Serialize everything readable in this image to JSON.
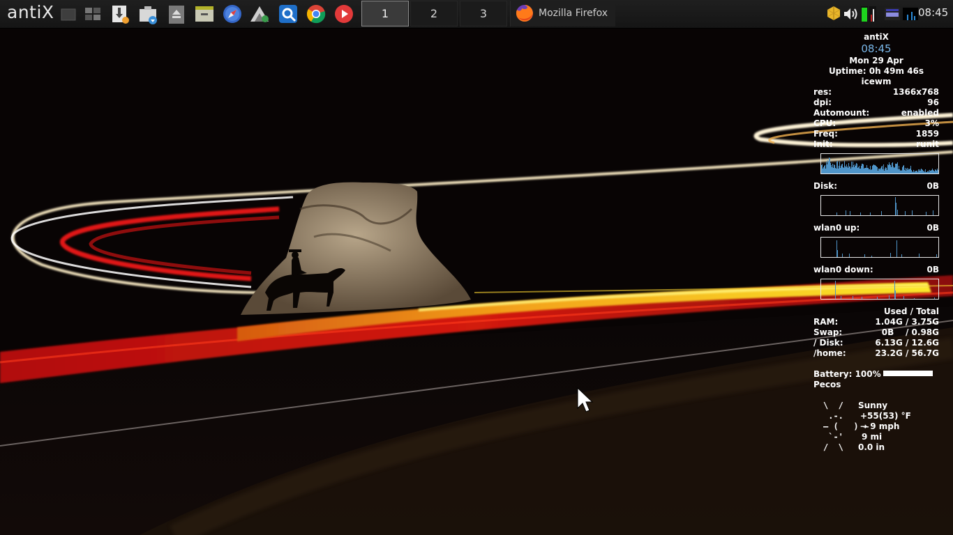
{
  "taskbar": {
    "start_label": "antiX",
    "launchers": [
      {
        "name": "show-desktop-icon"
      },
      {
        "name": "desktop-grid-icon"
      },
      {
        "name": "download-manager-icon"
      },
      {
        "name": "package-installer-icon"
      },
      {
        "name": "eject-icon"
      },
      {
        "name": "file-manager-icon"
      },
      {
        "name": "compass-browser-icon"
      },
      {
        "name": "mountain-app-icon"
      },
      {
        "name": "control-centre-icon"
      },
      {
        "name": "chrome-icon"
      },
      {
        "name": "media-player-icon"
      }
    ],
    "workspaces": [
      "1",
      "2",
      "3"
    ],
    "active_workspace": "1",
    "task": {
      "label": "Mozilla Firefox",
      "icon": "firefox-icon"
    },
    "tray_icons": [
      "updates-icon",
      "volume-icon",
      "cpu-monitor-icon",
      "network-icon",
      "battery-icon",
      "memory-monitor-icon"
    ],
    "clock": "08:45"
  },
  "conky": {
    "host": "antiX",
    "time": "08:45",
    "date": "Mon 29 Apr",
    "uptime": "Uptime: 0h 49m 46s",
    "wm": "icewm",
    "stats": [
      {
        "label": "res:",
        "value": "1366x768"
      },
      {
        "label": "dpi:",
        "value": "96"
      },
      {
        "label": "Automount:",
        "value": "enabled"
      },
      {
        "label": "CPU:",
        "value": "3%"
      },
      {
        "label": "Freq:",
        "value": "1859"
      },
      {
        "label": "Init:",
        "value": "runit"
      }
    ],
    "disk": {
      "label": "Disk:",
      "value": "0B"
    },
    "wlan_up": {
      "label": "wlan0 up:",
      "value": "0B"
    },
    "wlan_down": {
      "label": "wlan0 down:",
      "value": "0B"
    },
    "mem_header": "Used / Total",
    "mem": [
      {
        "label": "RAM:",
        "value": "1.04G / 3.75G"
      },
      {
        "label": "Swap:",
        "value": "0B    / 0.98G"
      },
      {
        "label": "/ Disk:",
        "value": "6.13G / 12.6G"
      },
      {
        "label": "/home:",
        "value": "23.2G / 56.7G"
      }
    ],
    "battery": {
      "label": "Battery: 100%",
      "level": 1.0
    },
    "location": "Pecos",
    "weather": {
      "art": [
        "\\  /",
        " .-.",
        "― (   ) ―",
        " `-'",
        "/  \\"
      ],
      "lines": [
        "Sunny",
        "+55(53) °F",
        "→ 9 mph",
        "9 mi",
        "0.0 in"
      ]
    }
  },
  "colors": {
    "taskbar_bg": "#1a1a1a",
    "conky_accent": "#7ab8ea",
    "graph_color": "#4f95c9"
  }
}
